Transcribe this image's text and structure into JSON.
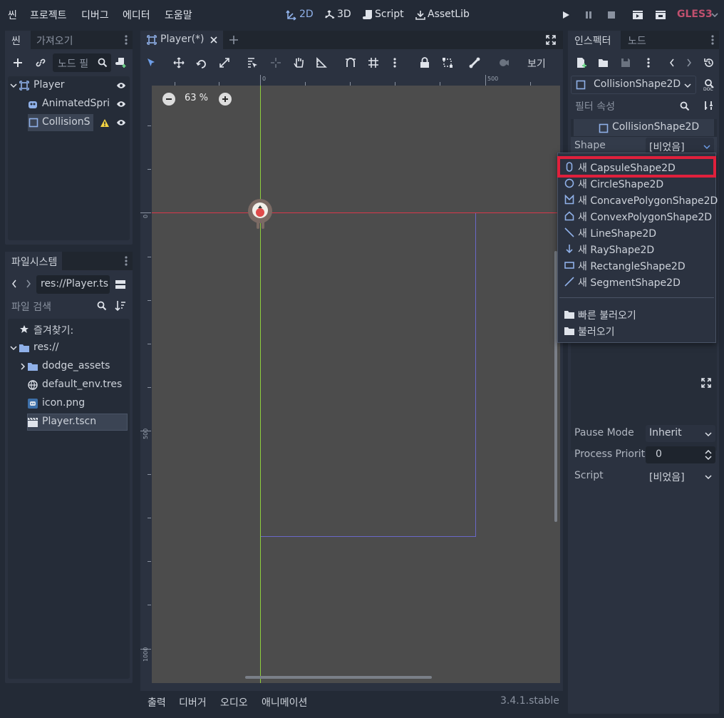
{
  "menu": {
    "scene": "씬",
    "project": "프로젝트",
    "debug": "디버그",
    "editor": "에디터",
    "help": "도움말"
  },
  "workspace": {
    "two_d": "2D",
    "three_d": "3D",
    "script": "Script",
    "assetlib": "AssetLib"
  },
  "renderer": "GLES3",
  "scene_dock": {
    "tab_scene": "씬",
    "tab_import": "가져오기",
    "filter_placeholder": "노드 필",
    "nodes": [
      {
        "label": "Player"
      },
      {
        "label": "AnimatedSpri"
      },
      {
        "label": "CollisionS"
      }
    ]
  },
  "fs_dock": {
    "tab": "파일시스템",
    "path": "res://Player.ts",
    "search_placeholder": "파일 검색",
    "items": [
      {
        "label": "즐겨찾기:"
      },
      {
        "label": "res://"
      },
      {
        "label": "dodge_assets"
      },
      {
        "label": "default_env.tres"
      },
      {
        "label": "icon.png"
      },
      {
        "label": "Player.tscn"
      }
    ]
  },
  "viewport": {
    "tab": "Player(*)",
    "zoom": "63 %",
    "view_label": "보기",
    "ruler_top": [
      "0",
      "500"
    ],
    "ruler_left": [
      "0",
      "500",
      "1000"
    ]
  },
  "bottom": {
    "output": "출력",
    "debugger": "디버거",
    "audio": "오디오",
    "animation": "애니메이션",
    "version": "3.4.1.stable"
  },
  "inspector": {
    "tab_inspector": "인스펙터",
    "tab_node": "노드",
    "object": "CollisionShape2D",
    "filter_placeholder": "필터 속성",
    "section": "CollisionShape2D",
    "shape_label": "Shape",
    "shape_value": "[비었음]",
    "pause_label": "Pause Mode",
    "pause_value": "Inherit",
    "priority_label": "Process Priorit",
    "priority_value": "0",
    "script_label": "Script",
    "script_value": "[비었음]"
  },
  "dropdown": {
    "items": [
      {
        "label": "새 CapsuleShape2D"
      },
      {
        "label": "새 CircleShape2D"
      },
      {
        "label": "새 ConcavePolygonShape2D"
      },
      {
        "label": "새 ConvexPolygonShape2D"
      },
      {
        "label": "새 LineShape2D"
      },
      {
        "label": "새 RayShape2D"
      },
      {
        "label": "새 RectangleShape2D"
      },
      {
        "label": "새 SegmentShape2D"
      }
    ],
    "quick_load": "빠른 불러오기",
    "load": "불러오기"
  },
  "colors": {
    "accent": "#6e9ee8",
    "highlight": "#e0203c",
    "renderer": "#c0506e",
    "icon_2d": "#8fb0e8",
    "warning": "#f5d442"
  }
}
